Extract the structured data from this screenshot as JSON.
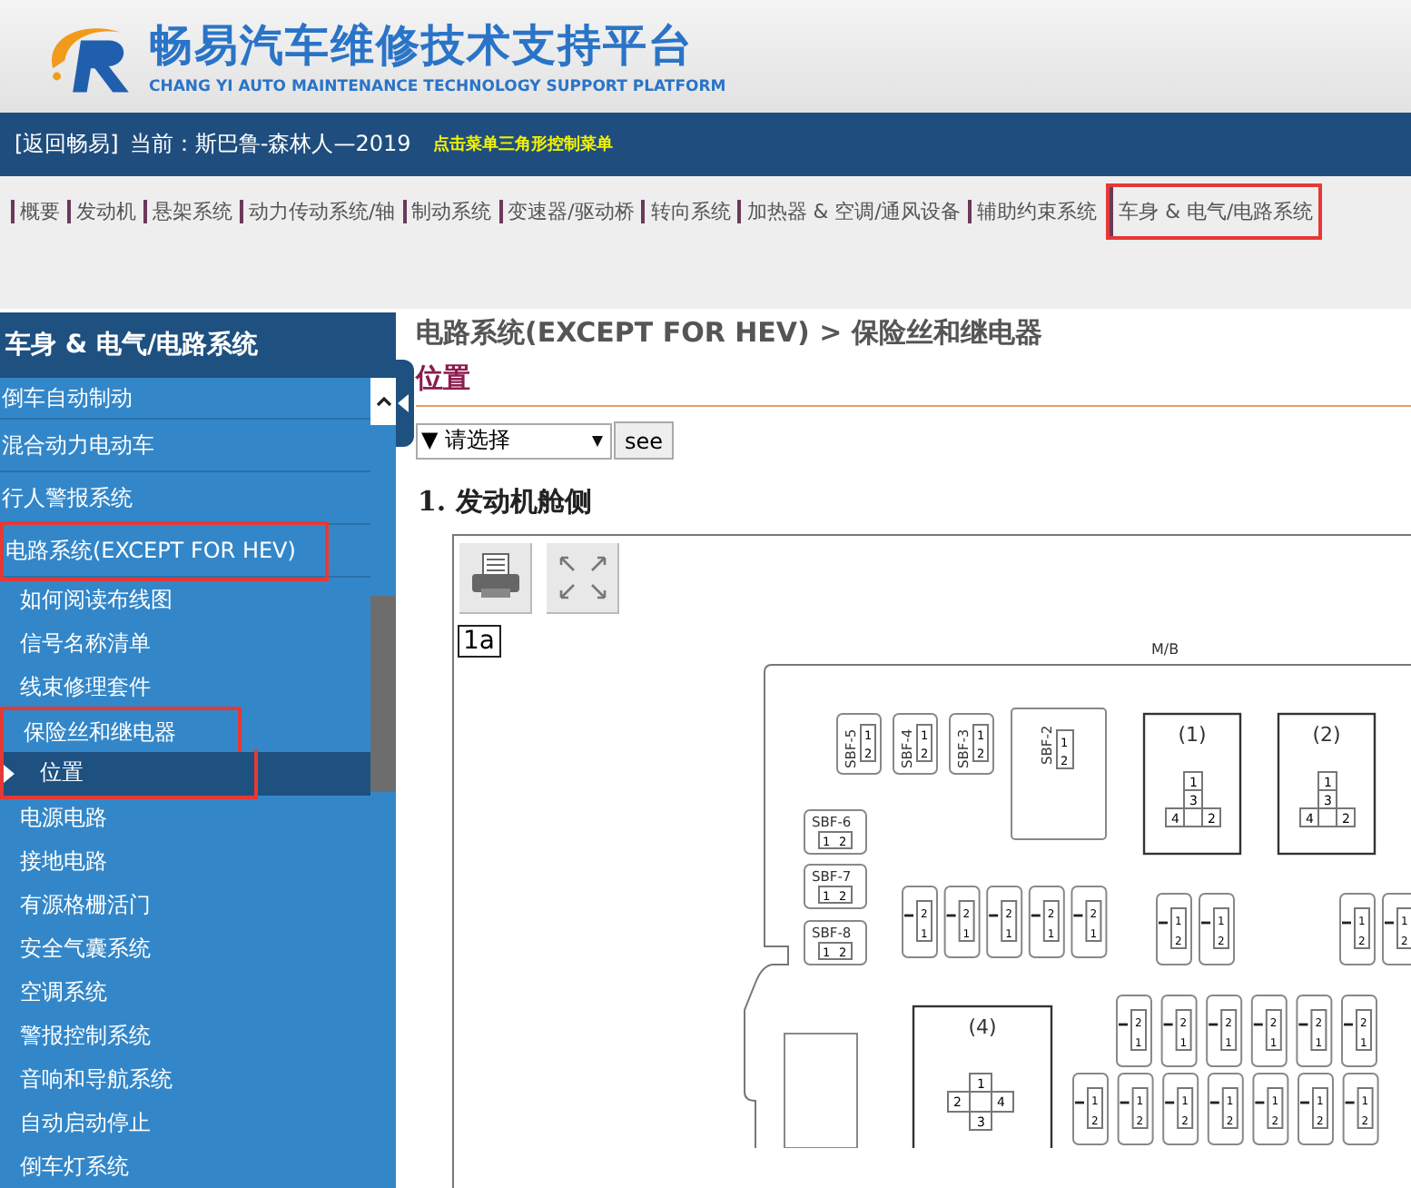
{
  "header": {
    "title": "畅易汽车维修技术支持平台",
    "subtitle": "CHANG YI AUTO MAINTENANCE TECHNOLOGY SUPPORT PLATFORM"
  },
  "info_bar": {
    "back_link": "[返回畅易]",
    "current": "当前：斯巴鲁-森林人—2019",
    "hint": "点击菜单三角形控制菜单"
  },
  "nav": [
    {
      "label": "概要",
      "highlighted": false
    },
    {
      "label": "发动机",
      "highlighted": false
    },
    {
      "label": "悬架系统",
      "highlighted": false
    },
    {
      "label": "动力传动系统/轴",
      "highlighted": false
    },
    {
      "label": "制动系统",
      "highlighted": false
    },
    {
      "label": "变速器/驱动桥",
      "highlighted": false
    },
    {
      "label": "转向系统",
      "highlighted": false
    },
    {
      "label": "加热器 & 空调/通风设备",
      "highlighted": false
    },
    {
      "label": "辅助约束系统",
      "highlighted": false
    },
    {
      "label": "车身 & 电气/电路系统",
      "highlighted": true
    }
  ],
  "sidebar": {
    "title": "车身 & 电气/电路系统",
    "items": [
      {
        "kind": "section",
        "label": "倒车自动制动",
        "selected": false,
        "highlighted": false
      },
      {
        "kind": "section",
        "label": "混合动力电动车",
        "selected": false,
        "highlighted": false
      },
      {
        "kind": "section",
        "label": "行人警报系统",
        "selected": false,
        "highlighted": false
      },
      {
        "kind": "section",
        "label": "电路系统(EXCEPT FOR HEV)",
        "selected": false,
        "highlighted": true
      },
      {
        "kind": "sub",
        "label": "如何阅读布线图",
        "selected": false,
        "highlighted": false
      },
      {
        "kind": "sub",
        "label": "信号名称清单",
        "selected": false,
        "highlighted": false
      },
      {
        "kind": "sub",
        "label": "线束修理套件",
        "selected": false,
        "highlighted": false
      },
      {
        "kind": "sub",
        "label": "保险丝和继电器",
        "selected": false,
        "highlighted": true
      },
      {
        "kind": "subsub",
        "label": "位置",
        "selected": true,
        "highlighted": true
      },
      {
        "kind": "sub",
        "label": "电源电路",
        "selected": false,
        "highlighted": false
      },
      {
        "kind": "sub",
        "label": "接地电路",
        "selected": false,
        "highlighted": false
      },
      {
        "kind": "sub",
        "label": "有源格栅活门",
        "selected": false,
        "highlighted": false
      },
      {
        "kind": "sub",
        "label": "安全气囊系统",
        "selected": false,
        "highlighted": false
      },
      {
        "kind": "sub",
        "label": "空调系统",
        "selected": false,
        "highlighted": false
      },
      {
        "kind": "sub",
        "label": "警报控制系统",
        "selected": false,
        "highlighted": false
      },
      {
        "kind": "sub",
        "label": "音响和导航系统",
        "selected": false,
        "highlighted": false
      },
      {
        "kind": "sub",
        "label": "自动启动停止",
        "selected": false,
        "highlighted": false
      },
      {
        "kind": "sub",
        "label": "倒车灯系统",
        "selected": false,
        "highlighted": false
      }
    ]
  },
  "content": {
    "breadcrumb": "电路系统(EXCEPT FOR HEV) > 保险丝和继电器",
    "page_title": "位置",
    "select": {
      "value": "▼ 请选择"
    },
    "see_button": "see",
    "section_title": "1. 发动机舱侧",
    "diagram": {
      "tag": "1a",
      "box_label": "M/B",
      "sbf": [
        {
          "name": "SBF-5",
          "pins": [
            "1",
            "2"
          ]
        },
        {
          "name": "SBF-4",
          "pins": [
            "1",
            "2"
          ]
        },
        {
          "name": "SBF-3",
          "pins": [
            "1",
            "2"
          ]
        },
        {
          "name": "SBF-2",
          "pins": [
            "1",
            "2"
          ]
        },
        {
          "name": "SBF-6",
          "pins": [
            "1",
            "2"
          ]
        },
        {
          "name": "SBF-7",
          "pins": [
            "1",
            "2"
          ]
        },
        {
          "name": "SBF-8",
          "pins": [
            "1",
            "2"
          ]
        }
      ],
      "relays": [
        {
          "label": "(1)",
          "pins": [
            "1",
            "3",
            "4",
            "2"
          ]
        },
        {
          "label": "(2)",
          "pins": [
            "1",
            "3",
            "4",
            "2"
          ]
        },
        {
          "label": "(4)",
          "pins": [
            "1",
            "2",
            "4",
            "3"
          ]
        }
      ],
      "fuse_rows": [
        {
          "fuses": [
            {
              "pins": [
                "2",
                "1"
              ]
            },
            {
              "pins": [
                "2",
                "1"
              ]
            },
            {
              "pins": [
                "2",
                "1"
              ]
            },
            {
              "pins": [
                "2",
                "1"
              ]
            },
            {
              "pins": [
                "2",
                "1"
              ]
            }
          ]
        },
        {
          "fuses": [
            {
              "pins": [
                "1",
                "2"
              ]
            },
            {
              "pins": [
                "1",
                "2"
              ]
            },
            {
              "pins": [
                "1",
                "2"
              ]
            },
            {
              "pins": [
                "1",
                "2"
              ]
            }
          ]
        },
        {
          "fuses": [
            {
              "pins": [
                "2",
                "1"
              ]
            },
            {
              "pins": [
                "2",
                "1"
              ]
            },
            {
              "pins": [
                "2",
                "1"
              ]
            },
            {
              "pins": [
                "2",
                "1"
              ]
            },
            {
              "pins": [
                "2",
                "1"
              ]
            },
            {
              "pins": [
                "2",
                "1"
              ]
            }
          ]
        },
        {
          "fuses": [
            {
              "pins": [
                "1",
                "2"
              ]
            },
            {
              "pins": [
                "1",
                "2"
              ]
            },
            {
              "pins": [
                "1",
                "2"
              ]
            },
            {
              "pins": [
                "1",
                "2"
              ]
            },
            {
              "pins": [
                "1",
                "2"
              ]
            },
            {
              "pins": [
                "1",
                "2"
              ]
            },
            {
              "pins": [
                "1",
                "2"
              ]
            }
          ]
        }
      ]
    }
  }
}
